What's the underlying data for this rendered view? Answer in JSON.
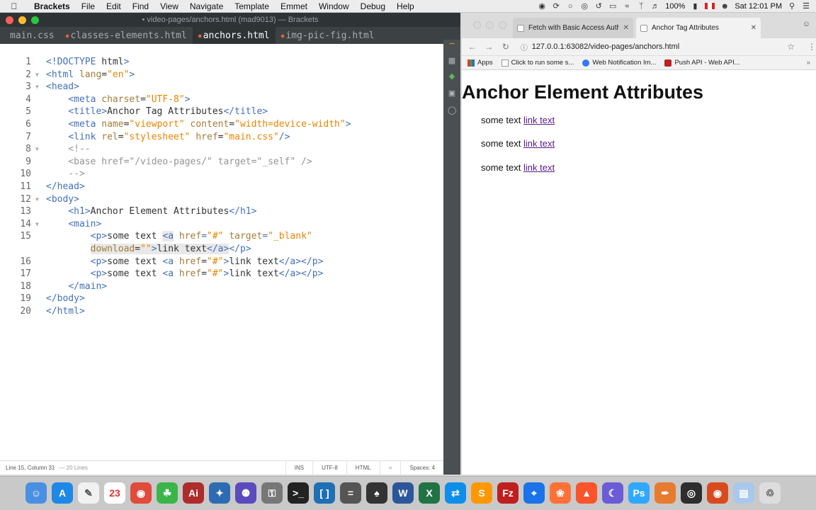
{
  "menubar": {
    "app_name": "Brackets",
    "items": [
      "File",
      "Edit",
      "Find",
      "View",
      "Navigate",
      "Template",
      "Emmet",
      "Window",
      "Debug",
      "Help"
    ],
    "battery": "100%",
    "datetime": "Sat 12:01 PM"
  },
  "brackets": {
    "window_title": "• video-pages/anchors.html (mad9013) — Brackets",
    "tabs": [
      {
        "label": "main.css"
      },
      {
        "label": "classes-elements.html"
      },
      {
        "label": "anchors.html"
      },
      {
        "label": "img-pic-fig.html"
      }
    ],
    "code_lines": [
      {
        "n": "1",
        "text": "<!DOCTYPE html>"
      },
      {
        "n": "2",
        "text": "<html lang=\"en\">"
      },
      {
        "n": "3",
        "text": "<head>"
      },
      {
        "n": "4",
        "text": "    <meta charset=\"UTF-8\">"
      },
      {
        "n": "5",
        "text": "    <title>Anchor Tag Attributes</title>"
      },
      {
        "n": "6",
        "text": "    <meta name=\"viewport\" content=\"width=device-width\">"
      },
      {
        "n": "7",
        "text": "    <link rel=\"stylesheet\" href=\"main.css\"/>"
      },
      {
        "n": "8",
        "text": "    <!--"
      },
      {
        "n": "9",
        "text": "    <base href=\"/video-pages/\" target=\"_self\" />"
      },
      {
        "n": "10",
        "text": "    -->"
      },
      {
        "n": "11",
        "text": "</head>"
      },
      {
        "n": "12",
        "text": "<body>"
      },
      {
        "n": "13",
        "text": "    <h1>Anchor Element Attributes</h1>"
      },
      {
        "n": "14",
        "text": "    <main>"
      },
      {
        "n": "15",
        "text": "        <p>some text <a href=\"#\" target=\"_blank\""
      },
      {
        "n": "",
        "text": "        download=\"\">link text</a></p>"
      },
      {
        "n": "16",
        "text": "        <p>some text <a href=\"#\">link text</a></p>"
      },
      {
        "n": "17",
        "text": "        <p>some text <a href=\"#\">link text</a></p>"
      },
      {
        "n": "18",
        "text": "    </main>"
      },
      {
        "n": "19",
        "text": "</body>"
      },
      {
        "n": "20",
        "text": "</html>"
      }
    ],
    "status": {
      "cursor": "Line 15, Column 31",
      "lines": "— 20 Lines",
      "mode": "INS",
      "encoding": "UTF-8",
      "language": "HTML",
      "spaces": "Spaces: 4"
    }
  },
  "chrome": {
    "tabs": [
      {
        "title": "Fetch with Basic Access Authe"
      },
      {
        "title": "Anchor Tag Attributes"
      }
    ],
    "url": "127.0.0.1:63082/video-pages/anchors.html",
    "bookmarks": [
      "Apps",
      "Click to run some s...",
      "Web Notification Im...",
      "Push API - Web API..."
    ],
    "page": {
      "heading": "Anchor Element Attributes",
      "paragraphs": [
        {
          "text": "some text",
          "link": "link text"
        },
        {
          "text": "some text",
          "link": "link text"
        },
        {
          "text": "some text",
          "link": "link text"
        }
      ]
    }
  },
  "dock": {
    "calendar_day": "23",
    "apps": [
      "finder-icon",
      "app-store-icon",
      "textedit-icon",
      "calendar-icon",
      "chrome-icon",
      "leaf-icon",
      "adobe-icon",
      "sourcetree-icon",
      "github-icon",
      "keychain-icon",
      "terminal-icon",
      "brackets-icon",
      "calculator-icon",
      "elephant-icon",
      "word-icon",
      "excel-icon",
      "teamviewer-icon",
      "sublime-icon",
      "filezilla-icon",
      "safari-icon",
      "firefox-icon",
      "brave-icon",
      "moon-icon",
      "photoshop-icon",
      "pen-icon",
      "aperture-icon",
      "chrome-canary-icon",
      "folder-icon",
      "trash-icon"
    ],
    "colors": [
      "#4a90e2",
      "#1e88e5",
      "#f1f1f1",
      "#ffffff",
      "#e04b3c",
      "#3bb54a",
      "#ad2c2c",
      "#2d6cb2",
      "#5b4bbd",
      "#777777",
      "#222222",
      "#1f6fb5",
      "#555555",
      "#333333",
      "#2b579a",
      "#217346",
      "#0e8ee9",
      "#ff9800",
      "#bf1f1f",
      "#1a73e8",
      "#ff7139",
      "#fb542b",
      "#6b5bd6",
      "#31a8ff",
      "#e57c2f",
      "#2e2e2e",
      "#d94b1f",
      "#a9c9ec",
      "#dddddd"
    ]
  }
}
